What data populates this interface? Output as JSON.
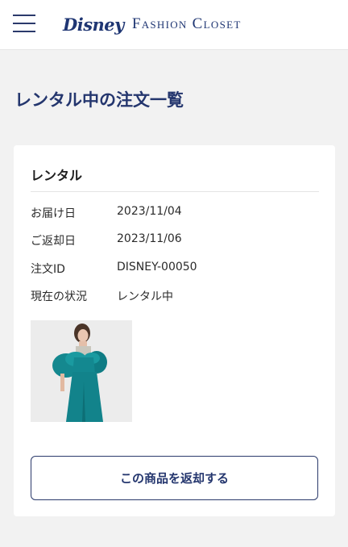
{
  "header": {
    "logo_brand": "Disney",
    "logo_name": "Fashion Closet"
  },
  "page": {
    "title": "レンタル中の注文一覧"
  },
  "order": {
    "section_title": "レンタル",
    "rows": [
      {
        "label": "お届け日",
        "value": "2023/11/04"
      },
      {
        "label": "ご返却日",
        "value": "2023/11/06"
      },
      {
        "label": "注文ID",
        "value": "DISNEY-00050"
      },
      {
        "label": "現在の状況",
        "value": "レンタル中"
      }
    ],
    "product_image": "model-in-teal-off-shoulder-jumpsuit",
    "return_button": "この商品を返却する"
  },
  "colors": {
    "brand_navy": "#1f3673",
    "background": "#f2f2f2",
    "product_teal": "#13878f"
  }
}
